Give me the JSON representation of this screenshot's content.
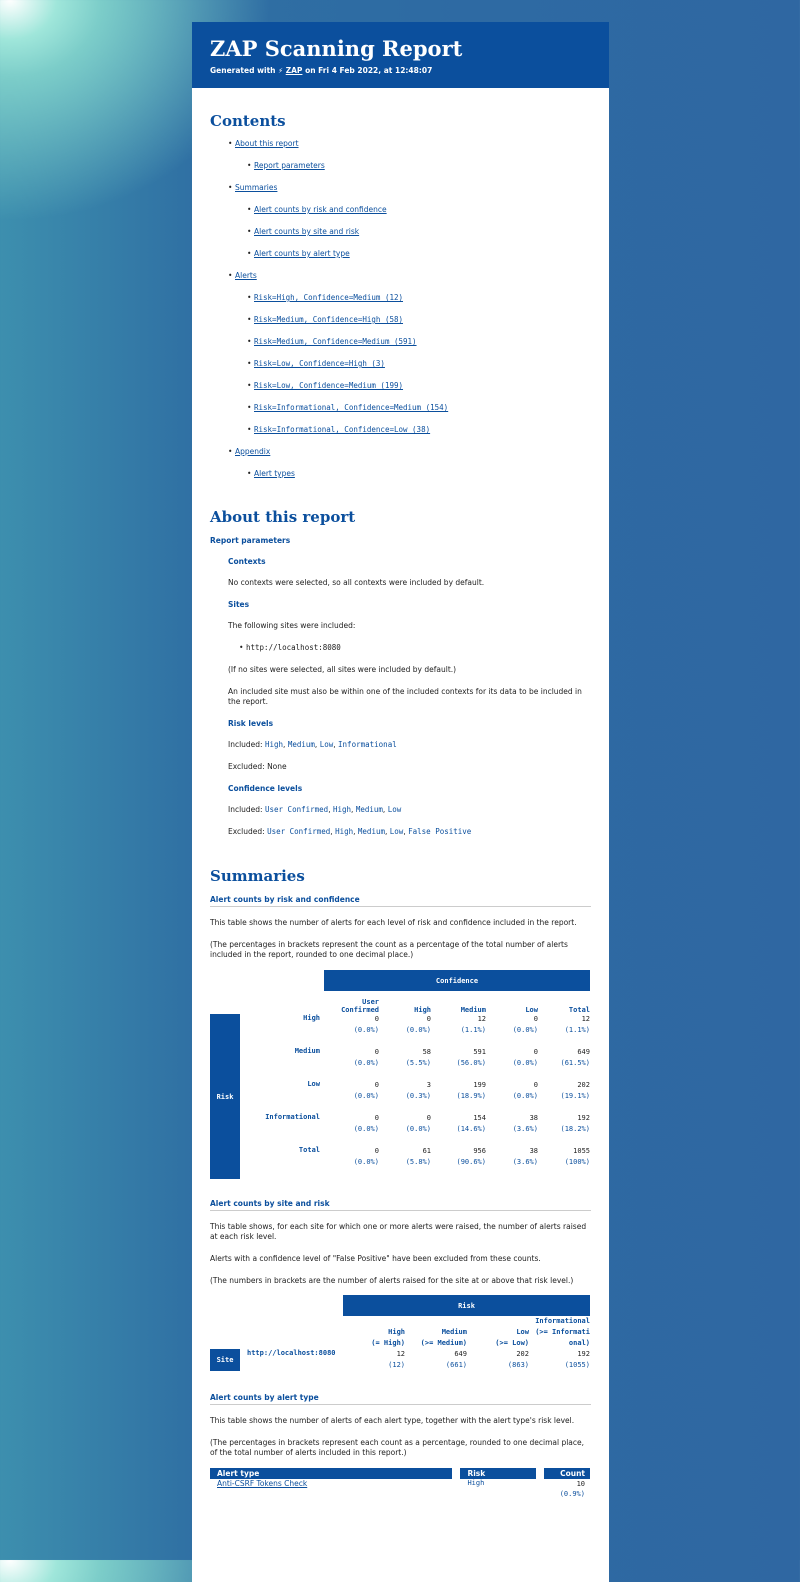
{
  "header": {
    "title": "ZAP Scanning Report",
    "generated_prefix": "Generated with",
    "zap_link": "ZAP",
    "generated_suffix": "on Fri 4 Feb 2022, at 12:48:07"
  },
  "contents": {
    "title": "Contents",
    "about": "About this report",
    "report_parameters": "Report parameters",
    "summaries": "Summaries",
    "risk_confidence": "Alert counts by risk and confidence",
    "site_risk": "Alert counts by site and risk",
    "alert_type": "Alert counts by alert type",
    "alerts": "Alerts",
    "alert_items": [
      "Risk=High, Confidence=Medium (12)",
      "Risk=Medium, Confidence=High (58)",
      "Risk=Medium, Confidence=Medium (591)",
      "Risk=Low, Confidence=High (3)",
      "Risk=Low, Confidence=Medium (199)",
      "Risk=Informational, Confidence=Medium (154)",
      "Risk=Informational, Confidence=Low (38)"
    ],
    "appendix": "Appendix",
    "alert_types": "Alert types"
  },
  "about": {
    "title": "About this report",
    "report_parameters": "Report parameters",
    "contexts_title": "Contexts",
    "contexts_text": "No contexts were selected, so all contexts were included by default.",
    "sites_title": "Sites",
    "sites_intro": "The following sites were included:",
    "site": "http://localhost:8080",
    "sites_note1": "(If no sites were selected, all sites were included by default.)",
    "sites_note2": "An included site must also be within one of the included contexts for its data to be included in the report.",
    "risk_levels_title": "Risk levels",
    "risk_included_label": "Included:",
    "risk_included": [
      "High",
      "Medium",
      "Low",
      "Informational"
    ],
    "risk_excluded_label": "Excluded:",
    "risk_excluded": "None",
    "conf_levels_title": "Confidence levels",
    "conf_included_label": "Included:",
    "conf_included": [
      "User Confirmed",
      "High",
      "Medium",
      "Low"
    ],
    "conf_excluded_label": "Excluded:",
    "conf_excluded": [
      "User Confirmed",
      "High",
      "Medium",
      "Low",
      "False Positive"
    ]
  },
  "summaries": {
    "title": "Summaries",
    "rc_title": "Alert counts by risk and confidence",
    "rc_text1": "This table shows the number of alerts for each level of risk and confidence included in the report.",
    "rc_text2": "(The percentages in brackets represent the count as a percentage of the total number of alerts included in the report, rounded to one decimal place.)",
    "rc_confidence_header": "Confidence",
    "rc_risk_header": "Risk",
    "rc_columns": [
      "User Confirmed",
      "High",
      "Medium",
      "Low",
      "Total"
    ],
    "rc_rows": [
      {
        "label": "High",
        "vals": [
          "0",
          "0",
          "12",
          "0",
          "12"
        ],
        "pcts": [
          "(0.0%)",
          "(0.0%)",
          "(1.1%)",
          "(0.0%)",
          "(1.1%)"
        ]
      },
      {
        "label": "Medium",
        "vals": [
          "0",
          "58",
          "591",
          "0",
          "649"
        ],
        "pcts": [
          "(0.0%)",
          "(5.5%)",
          "(56.0%)",
          "(0.0%)",
          "(61.5%)"
        ]
      },
      {
        "label": "Low",
        "vals": [
          "0",
          "3",
          "199",
          "0",
          "202"
        ],
        "pcts": [
          "(0.0%)",
          "(0.3%)",
          "(18.9%)",
          "(0.0%)",
          "(19.1%)"
        ]
      },
      {
        "label": "Informational",
        "vals": [
          "0",
          "0",
          "154",
          "38",
          "192"
        ],
        "pcts": [
          "(0.0%)",
          "(0.0%)",
          "(14.6%)",
          "(3.6%)",
          "(18.2%)"
        ]
      },
      {
        "label": "Total",
        "vals": [
          "0",
          "61",
          "956",
          "38",
          "1055"
        ],
        "pcts": [
          "(0.0%)",
          "(5.8%)",
          "(90.6%)",
          "(3.6%)",
          "(100%)"
        ]
      }
    ],
    "sr_title": "Alert counts by site and risk",
    "sr_text1": "This table shows, for each site for which one or more alerts were raised, the number of alerts raised at each risk level.",
    "sr_text2": "Alerts with a confidence level of \"False Positive\" have been excluded from these counts.",
    "sr_text3": "(The numbers in brackets are the number of alerts raised for the site at or above that risk level.)",
    "sr_risk_header": "Risk",
    "sr_site_header": "Site",
    "sr_columns": [
      {
        "l1": "",
        "l2": "High",
        "l3": "(= High)"
      },
      {
        "l1": "",
        "l2": "Medium",
        "l3": "(>= Medium)"
      },
      {
        "l1": "",
        "l2": "Low",
        "l3": "(>= Low)"
      },
      {
        "l1": "Informational",
        "l2": "(>= Informati",
        "l3": "onal)"
      }
    ],
    "sr_site": "http://localhost:8080",
    "sr_vals": [
      "12",
      "649",
      "202",
      "192"
    ],
    "sr_cum": [
      "(12)",
      "(661)",
      "(863)",
      "(1055)"
    ],
    "at_title": "Alert counts by alert type",
    "at_text1": "This table shows the number of alerts of each alert type, together with the alert type's risk level.",
    "at_text2": "(The percentages in brackets represent each count as a percentage, rounded to one decimal place, of the total number of alerts included in this report.)",
    "at_headers": [
      "Alert type",
      "Risk",
      "Count"
    ],
    "at_rows": [
      {
        "type": "Anti-CSRF Tokens Check",
        "risk": "High",
        "count": "10",
        "pct": "(0.9%)"
      }
    ]
  }
}
